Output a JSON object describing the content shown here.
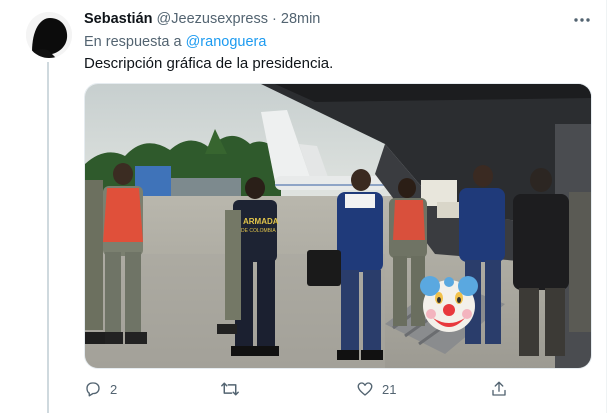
{
  "tweet": {
    "author_name": "Sebastián",
    "author_handle": "@Jeezusexpress",
    "separator": "·",
    "timestamp": "28min",
    "reply_prefix": "En respuesta a",
    "reply_mention": "@ranoguera",
    "text": "Descripción gráfica de la presidencia.",
    "media": {
      "vest_text_1": "ARMADA",
      "vest_text_2": "DE COLOMBIA",
      "overlay": "clown-face-emoji"
    },
    "actions": {
      "reply_count": "2",
      "retweet_count": "",
      "like_count": "21"
    }
  },
  "icons": [
    "more-icon",
    "reply-icon",
    "retweet-icon",
    "like-icon",
    "share-icon"
  ],
  "colors": {
    "text_primary": "#0f1419",
    "text_secondary": "#536471",
    "link": "#1d9bf0",
    "thread_line": "#cfd9de"
  }
}
